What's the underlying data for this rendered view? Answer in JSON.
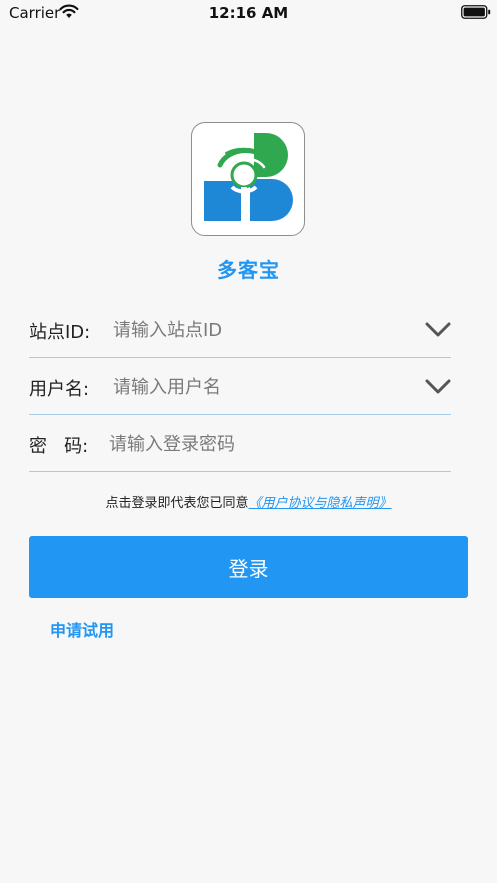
{
  "status_bar": {
    "carrier": "Carrier",
    "time": "12:16 AM",
    "icons": [
      "wifi-icon",
      "battery-icon"
    ]
  },
  "app": {
    "name": "多客宝",
    "logo": "duokebao-logo",
    "colors": {
      "accent": "#2196f3",
      "logo_blue": "#1e88d6",
      "logo_green": "#2fa84f"
    }
  },
  "form": {
    "station": {
      "label": "站点ID:",
      "placeholder": "请输入站点ID",
      "value": "",
      "icon": "chevron-down-icon"
    },
    "username": {
      "label": "用户名:",
      "placeholder": "请输入用户名",
      "value": "",
      "icon": "chevron-down-icon"
    },
    "password": {
      "label": "密   码:",
      "placeholder": "请输入登录密码",
      "value": ""
    }
  },
  "agreement": {
    "text": "点击登录即代表您已同意",
    "link": "《用户协议与隐私声明》"
  },
  "login_button": {
    "label": "登录"
  },
  "apply_trial": {
    "label": "申请试用"
  }
}
